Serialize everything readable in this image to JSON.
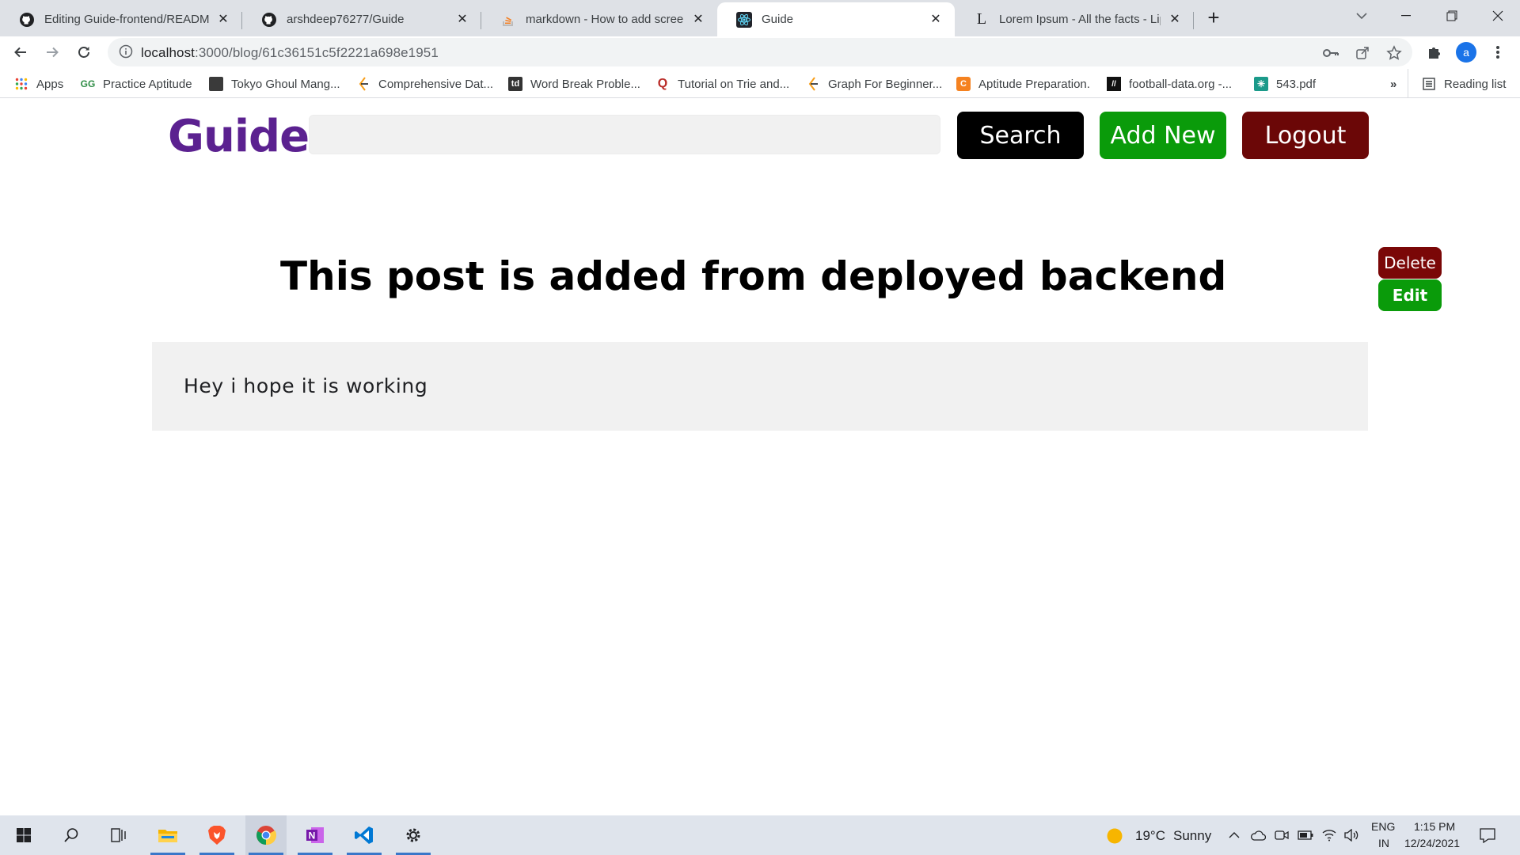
{
  "browser": {
    "tabs": [
      {
        "title": "Editing Guide-frontend/README",
        "icon": "github-icon"
      },
      {
        "title": "arshdeep76277/Guide",
        "icon": "github-icon"
      },
      {
        "title": "markdown - How to add screensh",
        "icon": "stackoverflow-icon"
      },
      {
        "title": "Guide",
        "icon": "react-icon",
        "active": true
      },
      {
        "title": "Lorem Ipsum - All the facts - Lips",
        "icon": "lipsum-icon"
      }
    ],
    "url_host": "localhost",
    "url_rest": ":3000/blog/61c36151c5f2221a698e1951",
    "profile_initial": "a",
    "bookmarks": [
      {
        "label": "Apps",
        "icon": "apps-grid-icon"
      },
      {
        "label": "Practice Aptitude",
        "icon": "gfg-icon"
      },
      {
        "label": "Tokyo Ghoul Mang...",
        "icon": "manga-icon"
      },
      {
        "label": "Comprehensive Dat...",
        "icon": "hackerrank-icon"
      },
      {
        "label": "Word Break Proble...",
        "icon": "td-icon"
      },
      {
        "label": "Tutorial on Trie and...",
        "icon": "quora-icon"
      },
      {
        "label": "Graph For Beginner...",
        "icon": "leetcode-icon"
      },
      {
        "label": "Aptitude Preparation.",
        "icon": "indiabix-icon"
      },
      {
        "label": "football-data.org -...",
        "icon": "football-data-icon"
      },
      {
        "label": "543.pdf",
        "icon": "pdf-icon"
      }
    ],
    "bookmarks_overflow": "»",
    "reading_list": "Reading list"
  },
  "app": {
    "brand": "Guide",
    "search_placeholder": "",
    "search_label": "Search",
    "add_new_label": "Add New",
    "logout_label": "Logout"
  },
  "post": {
    "title": "This post is added from deployed backend",
    "body": "Hey i hope it is working",
    "delete_label": "Delete",
    "edit_label": "Edit"
  },
  "taskbar": {
    "weather_temp": "19°C",
    "weather_desc": "Sunny",
    "lang_top": "ENG",
    "lang_bottom": "IN",
    "time": "1:15 PM",
    "date": "12/24/2021"
  },
  "colors": {
    "brand": "#5b2190",
    "search_btn": "#000000",
    "add_btn": "#0a9b0a",
    "logout_btn": "#6b0707",
    "delete_btn": "#7a0707",
    "edit_btn": "#0a9b0a",
    "post_body_bg": "#f1f1f1"
  }
}
